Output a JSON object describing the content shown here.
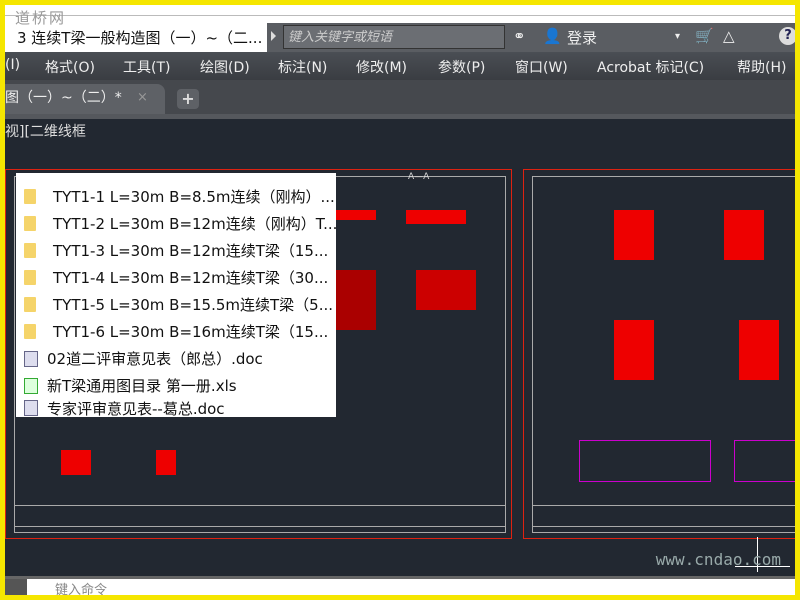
{
  "logo": "道桥网",
  "title": "3 连续T梁一般构造图（一）~（二...",
  "search": {
    "placeholder": "键入关键字或短语"
  },
  "toolbar": {
    "login": "登录",
    "help": "?"
  },
  "menu": [
    "(I)",
    "格式(O)",
    "工具(T)",
    "绘图(D)",
    "标注(N)",
    "修改(M)",
    "参数(P)",
    "窗口(W)",
    "Acrobat 标记(C)",
    "帮助(H)"
  ],
  "tab": {
    "label": "图（一）~（二）*",
    "close": "×",
    "add": "+"
  },
  "view_label": "视][二维线框",
  "drawing": {
    "section_label": "A—A"
  },
  "popup_items": [
    {
      "type": "folder",
      "label": "TYT1-1   L=30m B=8.5m连续（刚构）..."
    },
    {
      "type": "folder",
      "label": "TYT1-2   L=30m B=12m连续（刚构）T..."
    },
    {
      "type": "folder",
      "label": "TYT1-3   L=30m B=12m连续T梁（15..."
    },
    {
      "type": "folder",
      "label": "TYT1-4   L=30m B=12m连续T梁（30..."
    },
    {
      "type": "folder",
      "label": "TYT1-5   L=30m B=15.5m连续T梁（5..."
    },
    {
      "type": "folder",
      "label": "TYT1-6   L=30m B=16m连续T梁（15..."
    },
    {
      "type": "doc",
      "label": "02道二评审意见表（郎总）.doc"
    },
    {
      "type": "xls",
      "label": "新T梁通用图目录 第一册.xls"
    },
    {
      "type": "doc",
      "label": "专家评审意见表--葛总.doc"
    }
  ],
  "command": {
    "placeholder": "键入命令"
  },
  "watermark": "www.cndao.com"
}
